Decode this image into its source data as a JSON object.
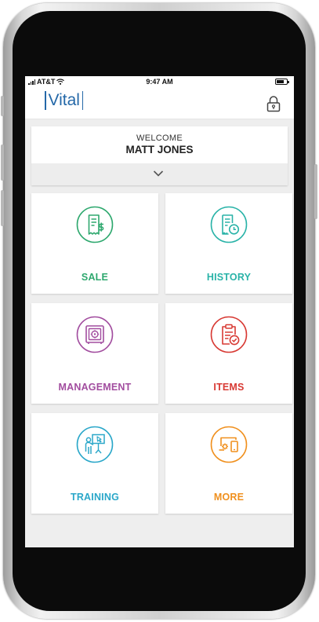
{
  "status_bar": {
    "carrier": "AT&T",
    "time": "9:47 AM"
  },
  "app": {
    "logo_text": "Vital"
  },
  "welcome": {
    "label": "WELCOME",
    "name": "MATT JONES"
  },
  "tiles": [
    {
      "label": "SALE",
      "icon": "sale-receipt-icon",
      "color": "#2ea86e"
    },
    {
      "label": "HISTORY",
      "icon": "history-receipt-icon",
      "color": "#2ab3a8"
    },
    {
      "label": "MANAGEMENT",
      "icon": "safe-icon",
      "color": "#a24d9f"
    },
    {
      "label": "ITEMS",
      "icon": "clipboard-check-icon",
      "color": "#d83a34"
    },
    {
      "label": "TRAINING",
      "icon": "presentation-icon",
      "color": "#2aa7c9"
    },
    {
      "label": "MORE",
      "icon": "devices-gear-icon",
      "color": "#f0901e"
    }
  ]
}
